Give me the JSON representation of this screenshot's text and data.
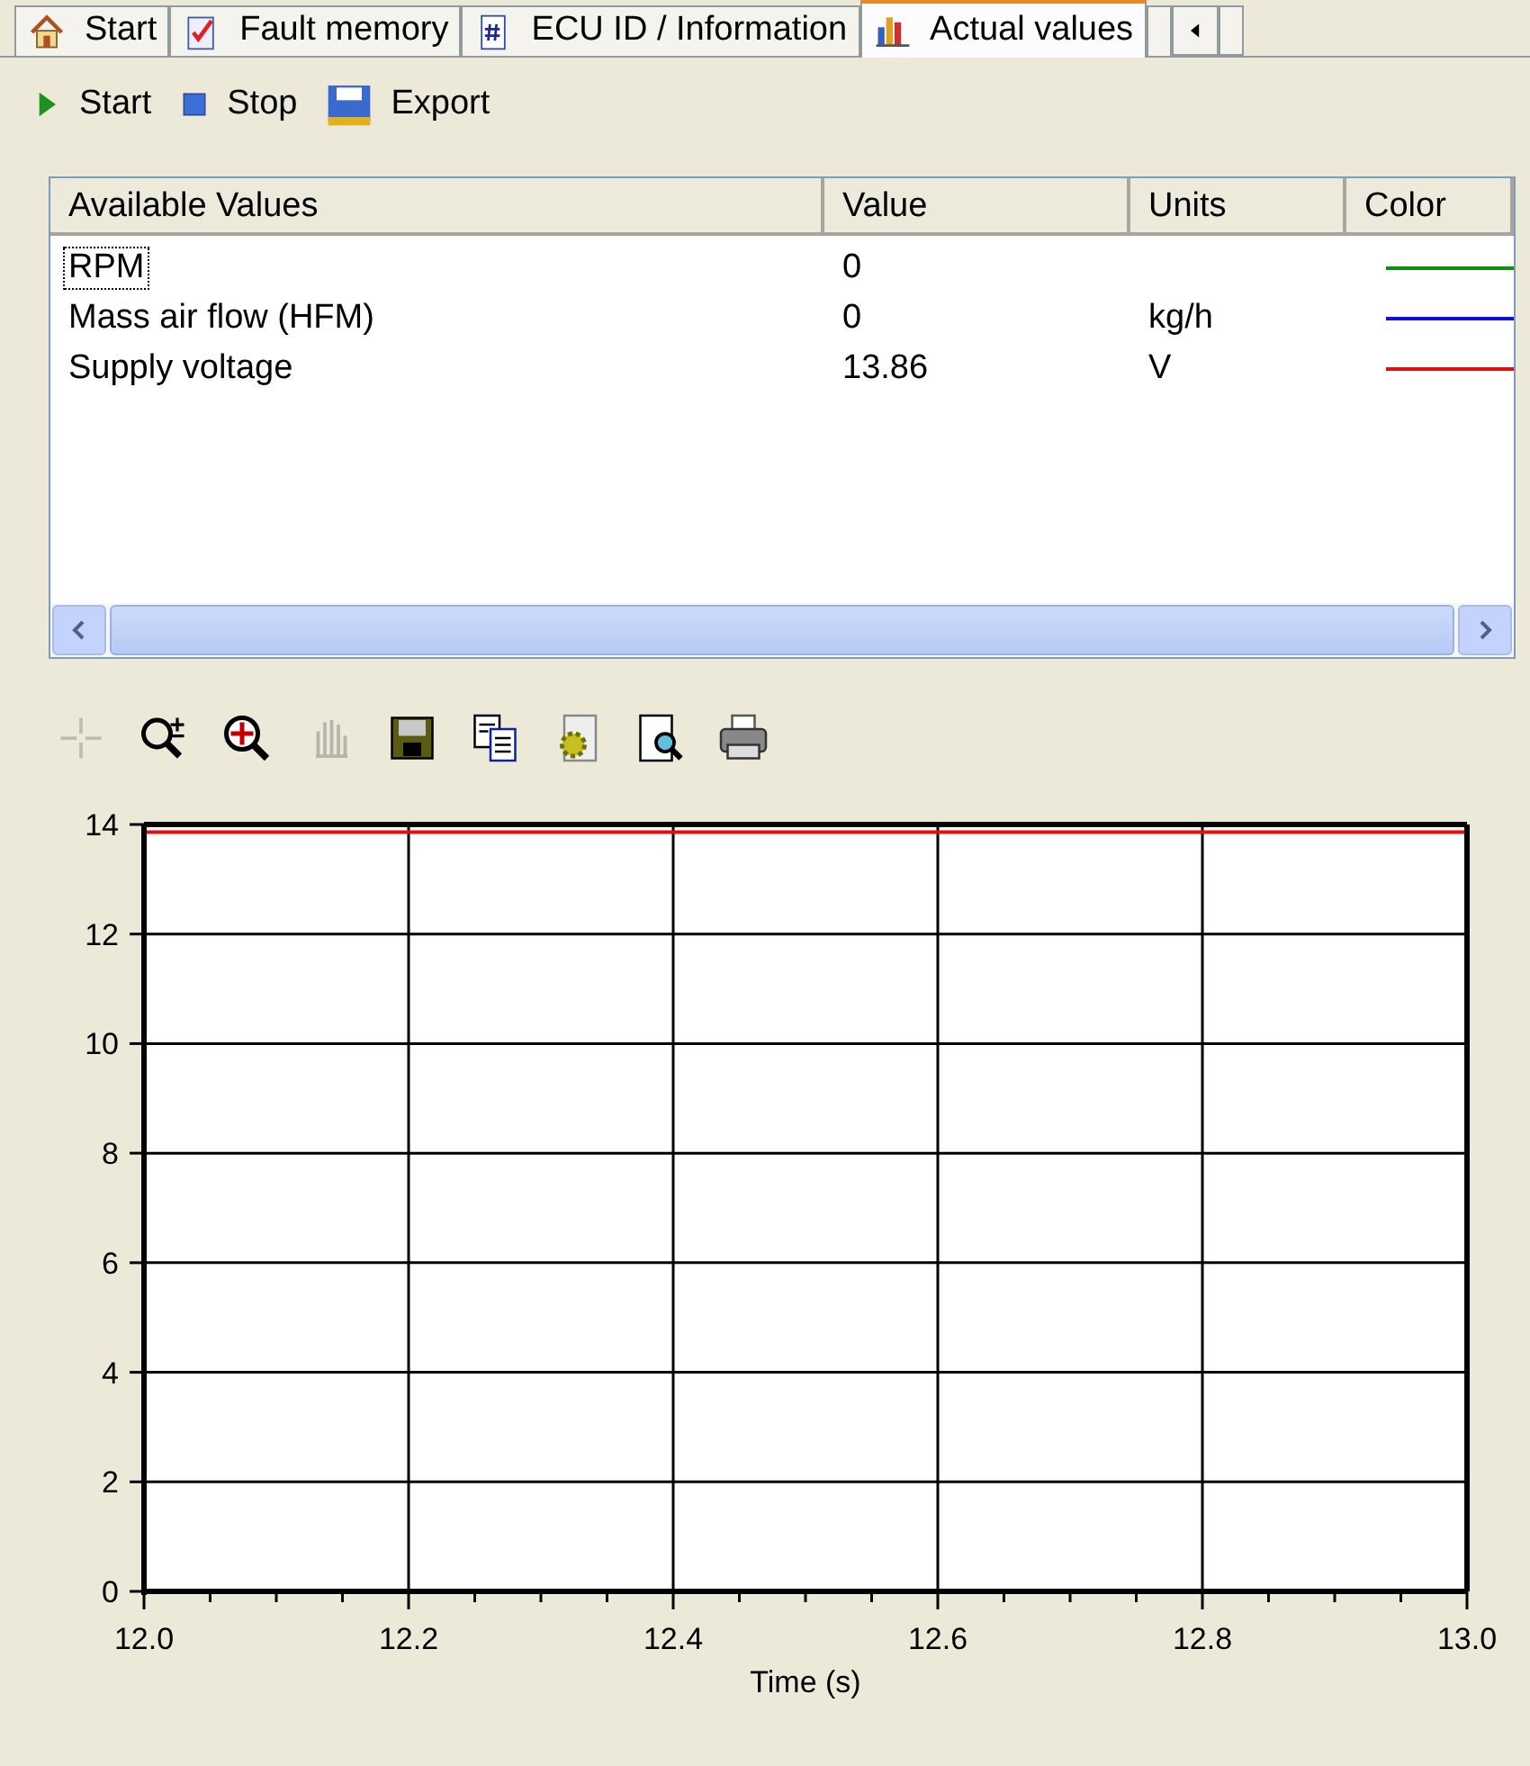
{
  "tabs": [
    {
      "label": "Start",
      "kind": "house",
      "selected": false
    },
    {
      "label": "Fault memory",
      "kind": "checklist",
      "selected": false
    },
    {
      "label": "ECU ID / Information",
      "kind": "hash",
      "selected": false
    },
    {
      "label": "Actual values",
      "kind": "bars",
      "selected": true
    }
  ],
  "toolbar": [
    {
      "label": "Start",
      "kind": "play"
    },
    {
      "label": "Stop",
      "kind": "stop"
    },
    {
      "label": "Export",
      "kind": "export"
    }
  ],
  "list": {
    "columns": [
      "Available Values",
      "Value",
      "Units",
      "Color"
    ],
    "rows": [
      {
        "name": "RPM",
        "value": "0",
        "units": "",
        "color": "#109010",
        "selected": true
      },
      {
        "name": "Mass air flow (HFM)",
        "value": "0",
        "units": "kg/h",
        "color": "#1010e0",
        "selected": false
      },
      {
        "name": "Supply voltage",
        "value": "13.86",
        "units": "V",
        "color": "#e01010",
        "selected": false
      }
    ]
  },
  "chart_tools": [
    {
      "kind": "crosshair",
      "disabled": true
    },
    {
      "kind": "zoom",
      "disabled": false
    },
    {
      "kind": "zoom-center",
      "disabled": false
    },
    {
      "kind": "pan",
      "disabled": true
    },
    {
      "kind": "save",
      "disabled": false
    },
    {
      "kind": "copy",
      "disabled": false
    },
    {
      "kind": "settings",
      "disabled": false
    },
    {
      "kind": "preview",
      "disabled": false
    },
    {
      "kind": "print",
      "disabled": false
    }
  ],
  "chart": {
    "chart_data": {
      "type": "line",
      "xlabel": "Time (s)",
      "x": [
        12.0,
        13.0
      ],
      "series": [
        {
          "color": "#e01010",
          "values": [
            13.86,
            13.86
          ]
        }
      ],
      "grid": true,
      "xlim": [
        12.0,
        13.0
      ],
      "ylim": [
        0,
        14
      ],
      "xticks": [
        {
          "value": 12.0,
          "label": "12.0"
        },
        {
          "value": 12.2,
          "label": "12.2"
        },
        {
          "value": 12.4,
          "label": "12.4"
        },
        {
          "value": 12.6,
          "label": "12.6"
        },
        {
          "value": 12.8,
          "label": "12.8"
        },
        {
          "value": 13.0,
          "label": "13.0"
        }
      ],
      "yticks": [
        0,
        2,
        4,
        6,
        8,
        10,
        12,
        14
      ]
    }
  }
}
